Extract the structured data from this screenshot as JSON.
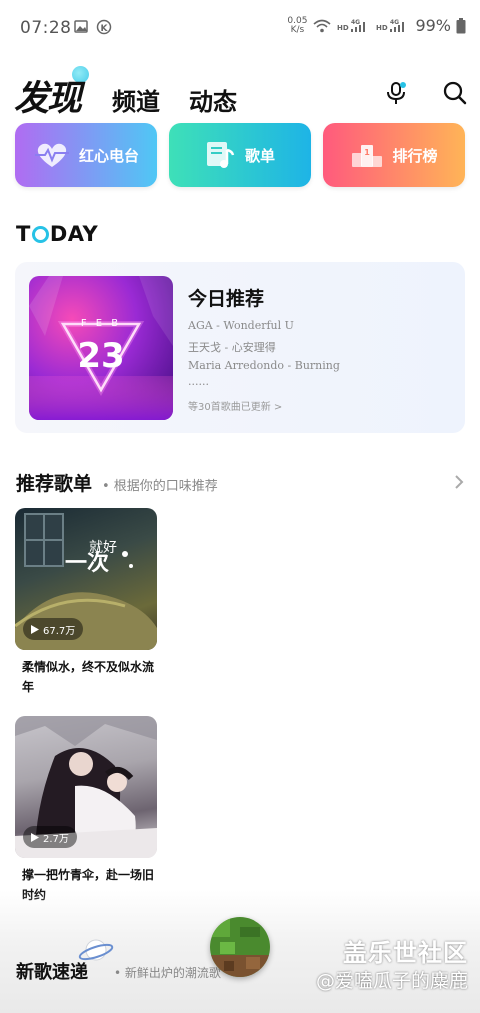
{
  "status_bar": {
    "time": "07:28",
    "net_speed_top": "0.05",
    "net_speed_bottom": "K/s",
    "battery": "99%"
  },
  "header": {
    "logo": "发现",
    "tabs": [
      "频道",
      "动态"
    ]
  },
  "categories": [
    {
      "label": "红心电台",
      "icon": "heart-pulse-icon",
      "colors": [
        "#b06cf2",
        "#4fc7f5"
      ]
    },
    {
      "label": "歌单",
      "icon": "music-note-icon",
      "colors": [
        "#3ee0b8",
        "#1eb4e6"
      ]
    },
    {
      "label": "排行榜",
      "icon": "podium-icon",
      "colors": [
        "#ff5a7d",
        "#ffb457"
      ]
    }
  ],
  "today": {
    "title_prefix": "T",
    "title_suffix": "DAY",
    "cover_month": "F E B",
    "cover_day": "23",
    "heading": "今日推荐",
    "lines": [
      "AGA - Wonderful U",
      "王天戈 - 心安理得",
      "Maria Arredondo - Burning",
      "......"
    ],
    "update_text": "等30首歌曲已更新 >"
  },
  "playlists": {
    "title": "推荐歌单",
    "subtitle": "• 根据你的口味推荐",
    "items": [
      {
        "count": "67.7万",
        "name": "柔情似水，终不及似水流年"
      },
      {
        "count": "2.7万",
        "name": "撑一把竹青伞，赴一场旧时约"
      }
    ]
  },
  "new_songs": {
    "title": "新歌速递",
    "subtitle": "• 新鲜出炉的潮流歌"
  },
  "watermark": {
    "title": "盖乐世社区",
    "sub": "@爱嗑瓜子的麋鹿"
  }
}
